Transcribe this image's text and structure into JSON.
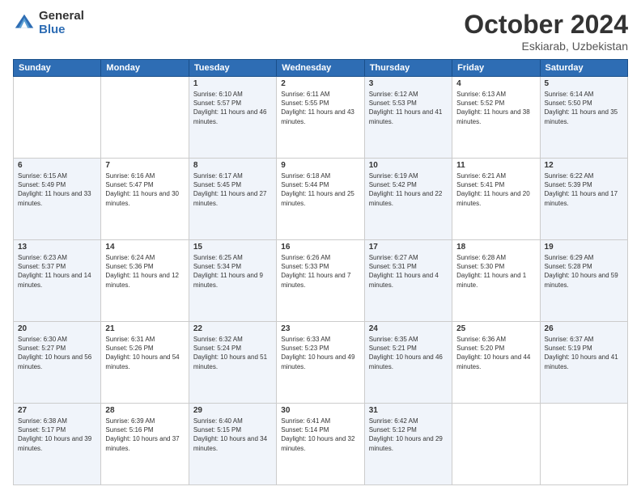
{
  "header": {
    "logo_general": "General",
    "logo_blue": "Blue",
    "month": "October 2024",
    "location": "Eskiarab, Uzbekistan"
  },
  "days_of_week": [
    "Sunday",
    "Monday",
    "Tuesday",
    "Wednesday",
    "Thursday",
    "Friday",
    "Saturday"
  ],
  "weeks": [
    [
      {
        "day": "",
        "info": ""
      },
      {
        "day": "",
        "info": ""
      },
      {
        "day": "1",
        "info": "Sunrise: 6:10 AM\nSunset: 5:57 PM\nDaylight: 11 hours and 46 minutes."
      },
      {
        "day": "2",
        "info": "Sunrise: 6:11 AM\nSunset: 5:55 PM\nDaylight: 11 hours and 43 minutes."
      },
      {
        "day": "3",
        "info": "Sunrise: 6:12 AM\nSunset: 5:53 PM\nDaylight: 11 hours and 41 minutes."
      },
      {
        "day": "4",
        "info": "Sunrise: 6:13 AM\nSunset: 5:52 PM\nDaylight: 11 hours and 38 minutes."
      },
      {
        "day": "5",
        "info": "Sunrise: 6:14 AM\nSunset: 5:50 PM\nDaylight: 11 hours and 35 minutes."
      }
    ],
    [
      {
        "day": "6",
        "info": "Sunrise: 6:15 AM\nSunset: 5:49 PM\nDaylight: 11 hours and 33 minutes."
      },
      {
        "day": "7",
        "info": "Sunrise: 6:16 AM\nSunset: 5:47 PM\nDaylight: 11 hours and 30 minutes."
      },
      {
        "day": "8",
        "info": "Sunrise: 6:17 AM\nSunset: 5:45 PM\nDaylight: 11 hours and 27 minutes."
      },
      {
        "day": "9",
        "info": "Sunrise: 6:18 AM\nSunset: 5:44 PM\nDaylight: 11 hours and 25 minutes."
      },
      {
        "day": "10",
        "info": "Sunrise: 6:19 AM\nSunset: 5:42 PM\nDaylight: 11 hours and 22 minutes."
      },
      {
        "day": "11",
        "info": "Sunrise: 6:21 AM\nSunset: 5:41 PM\nDaylight: 11 hours and 20 minutes."
      },
      {
        "day": "12",
        "info": "Sunrise: 6:22 AM\nSunset: 5:39 PM\nDaylight: 11 hours and 17 minutes."
      }
    ],
    [
      {
        "day": "13",
        "info": "Sunrise: 6:23 AM\nSunset: 5:37 PM\nDaylight: 11 hours and 14 minutes."
      },
      {
        "day": "14",
        "info": "Sunrise: 6:24 AM\nSunset: 5:36 PM\nDaylight: 11 hours and 12 minutes."
      },
      {
        "day": "15",
        "info": "Sunrise: 6:25 AM\nSunset: 5:34 PM\nDaylight: 11 hours and 9 minutes."
      },
      {
        "day": "16",
        "info": "Sunrise: 6:26 AM\nSunset: 5:33 PM\nDaylight: 11 hours and 7 minutes."
      },
      {
        "day": "17",
        "info": "Sunrise: 6:27 AM\nSunset: 5:31 PM\nDaylight: 11 hours and 4 minutes."
      },
      {
        "day": "18",
        "info": "Sunrise: 6:28 AM\nSunset: 5:30 PM\nDaylight: 11 hours and 1 minute."
      },
      {
        "day": "19",
        "info": "Sunrise: 6:29 AM\nSunset: 5:28 PM\nDaylight: 10 hours and 59 minutes."
      }
    ],
    [
      {
        "day": "20",
        "info": "Sunrise: 6:30 AM\nSunset: 5:27 PM\nDaylight: 10 hours and 56 minutes."
      },
      {
        "day": "21",
        "info": "Sunrise: 6:31 AM\nSunset: 5:26 PM\nDaylight: 10 hours and 54 minutes."
      },
      {
        "day": "22",
        "info": "Sunrise: 6:32 AM\nSunset: 5:24 PM\nDaylight: 10 hours and 51 minutes."
      },
      {
        "day": "23",
        "info": "Sunrise: 6:33 AM\nSunset: 5:23 PM\nDaylight: 10 hours and 49 minutes."
      },
      {
        "day": "24",
        "info": "Sunrise: 6:35 AM\nSunset: 5:21 PM\nDaylight: 10 hours and 46 minutes."
      },
      {
        "day": "25",
        "info": "Sunrise: 6:36 AM\nSunset: 5:20 PM\nDaylight: 10 hours and 44 minutes."
      },
      {
        "day": "26",
        "info": "Sunrise: 6:37 AM\nSunset: 5:19 PM\nDaylight: 10 hours and 41 minutes."
      }
    ],
    [
      {
        "day": "27",
        "info": "Sunrise: 6:38 AM\nSunset: 5:17 PM\nDaylight: 10 hours and 39 minutes."
      },
      {
        "day": "28",
        "info": "Sunrise: 6:39 AM\nSunset: 5:16 PM\nDaylight: 10 hours and 37 minutes."
      },
      {
        "day": "29",
        "info": "Sunrise: 6:40 AM\nSunset: 5:15 PM\nDaylight: 10 hours and 34 minutes."
      },
      {
        "day": "30",
        "info": "Sunrise: 6:41 AM\nSunset: 5:14 PM\nDaylight: 10 hours and 32 minutes."
      },
      {
        "day": "31",
        "info": "Sunrise: 6:42 AM\nSunset: 5:12 PM\nDaylight: 10 hours and 29 minutes."
      },
      {
        "day": "",
        "info": ""
      },
      {
        "day": "",
        "info": ""
      }
    ]
  ]
}
